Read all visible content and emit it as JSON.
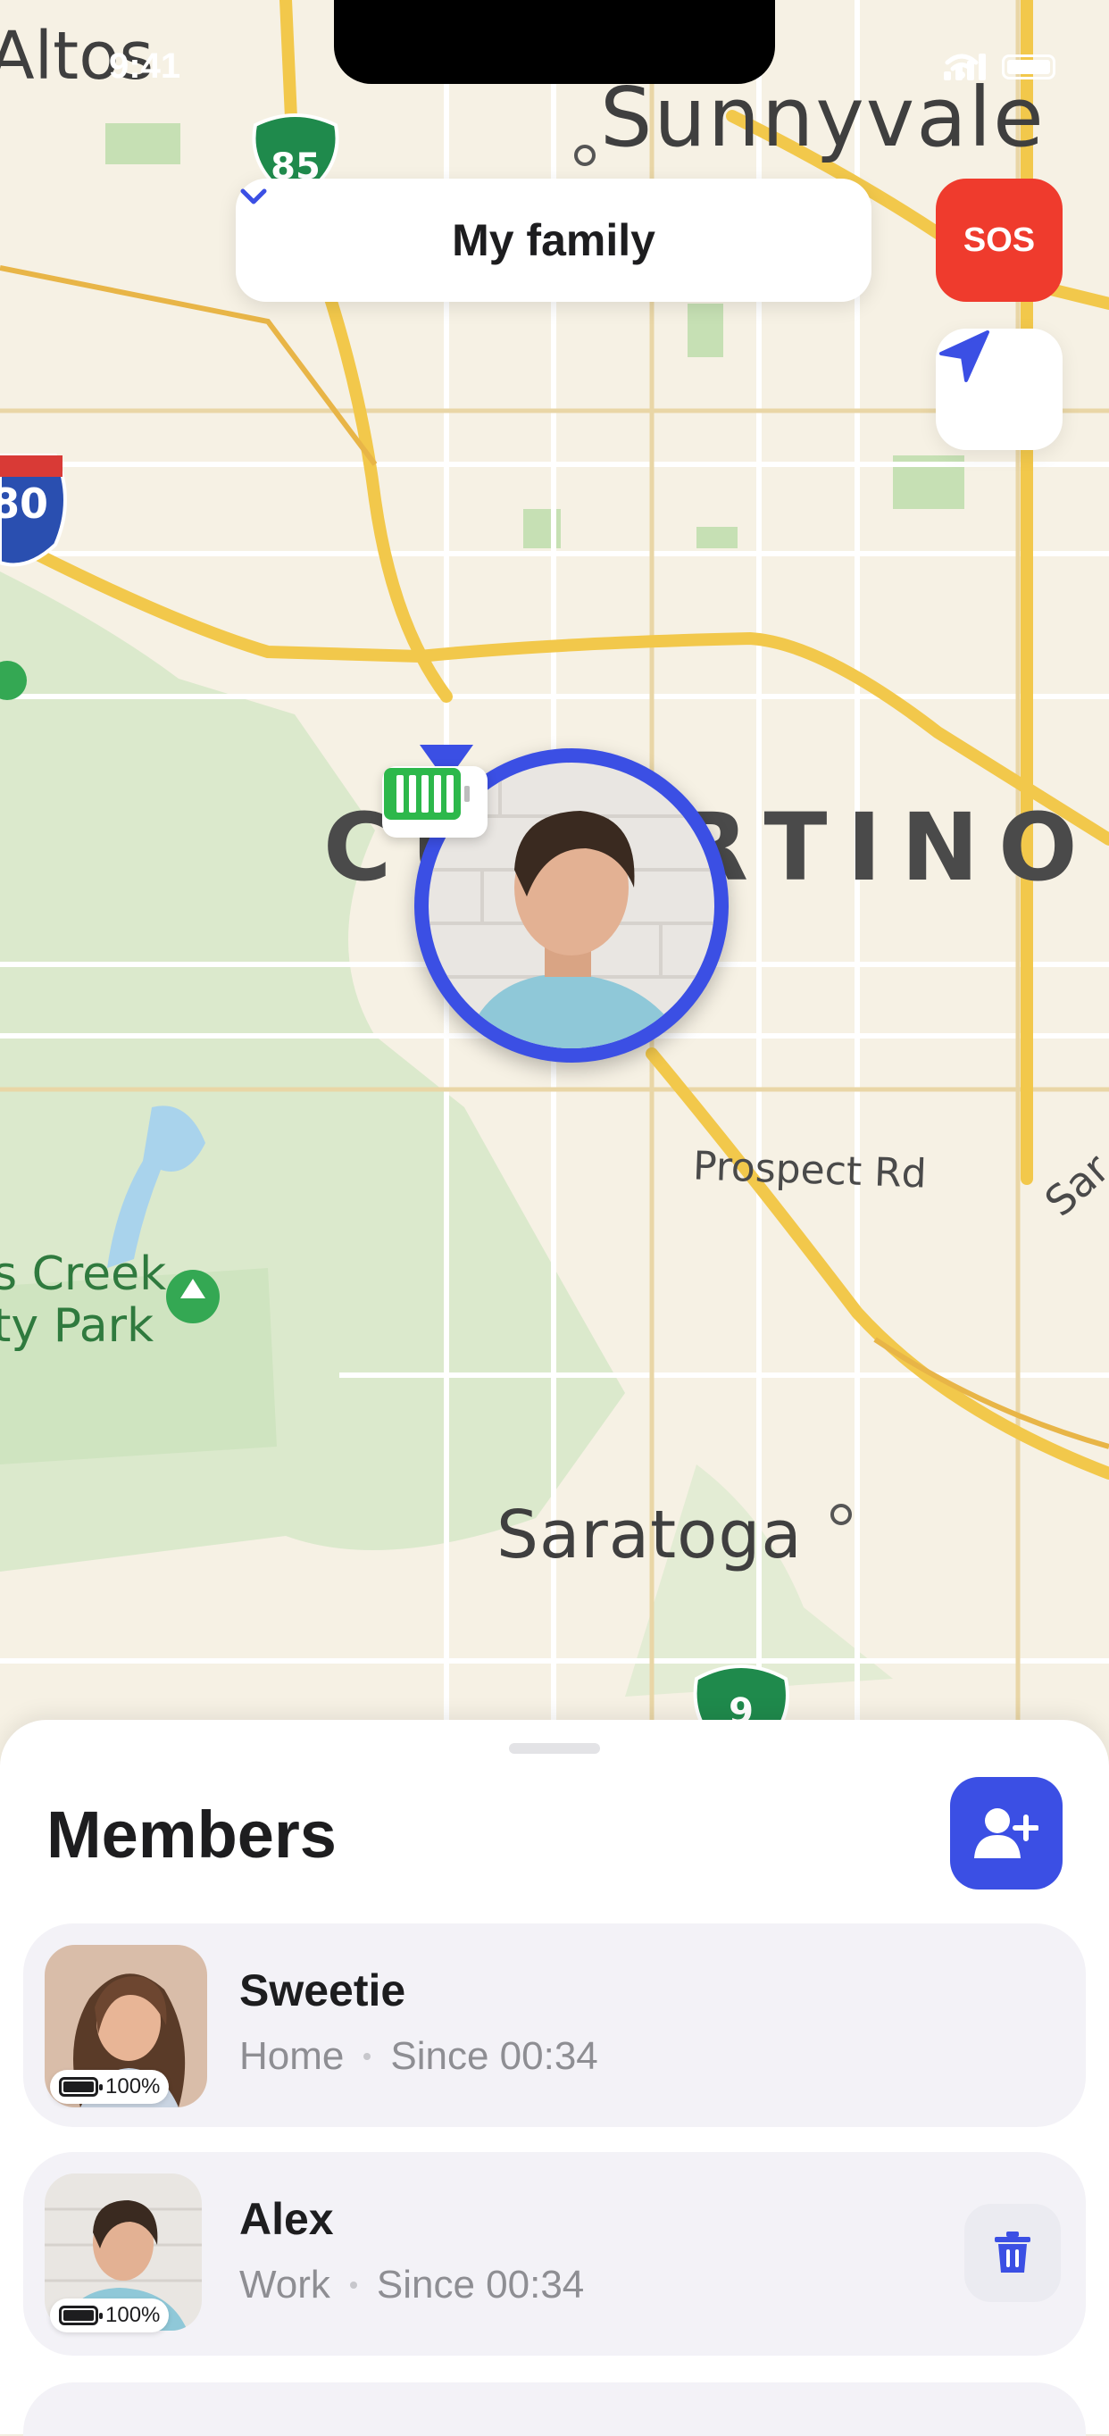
{
  "status_bar": {
    "time": "9:41"
  },
  "map": {
    "labels": {
      "altos": "Altos",
      "sunnyvale": "Sunnyvale",
      "cupertino": "CUPERTINO",
      "prospect": "Prospect Rd",
      "sara_right": "Sar",
      "saratoga": "Saratoga",
      "creek": "s Creek\nty Park",
      "hw85": "85",
      "hw280": "80",
      "hw9": "9"
    },
    "road_color": "#f2c84b",
    "park_color": "#d6e8c8"
  },
  "header": {
    "group_label": "My family",
    "sos_label": "SOS",
    "chevron_icon": "chevron-down-icon",
    "locate_icon": "navigation-arrow-icon"
  },
  "marker": {
    "battery_level": 1.0,
    "accent": "#3b4fe4",
    "battery_color": "#2db84b"
  },
  "members_sheet": {
    "title": "Members",
    "add_icon": "add-person-icon",
    "members": [
      {
        "name": "Sweetie",
        "place": "Home",
        "since": "Since 00:34",
        "battery": "100%"
      },
      {
        "name": "Alex",
        "place": "Work",
        "since": "Since 00:34",
        "battery": "100%",
        "action_icon": "trash-icon"
      }
    ]
  },
  "colors": {
    "accent": "#3b4fe4",
    "sos": "#ef3b2d",
    "text_primary": "#1d1d1f",
    "text_secondary": "#8e8e93"
  }
}
